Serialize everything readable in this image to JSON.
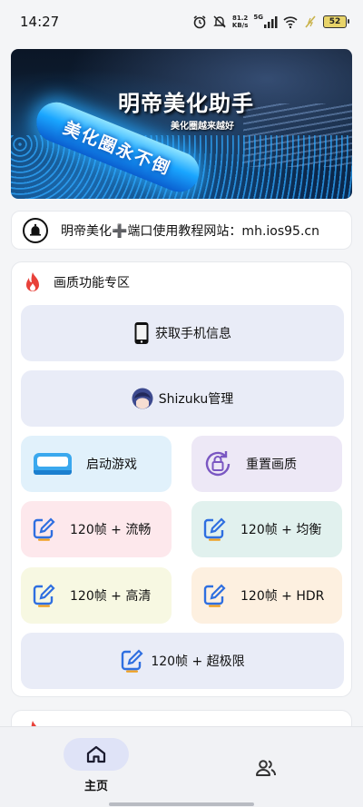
{
  "status_bar": {
    "time": "14:27",
    "net_speed_value": "81.2",
    "net_speed_unit": "KB/s",
    "signal_label": "5G",
    "battery": "52"
  },
  "banner": {
    "title": "明帝美化助手",
    "subtitle": "美化圈越来越好",
    "glowstick_text": "美化圈永不倒"
  },
  "notice": {
    "icon": "bell-icon",
    "text": "明帝美化➕端口使用教程网站：mh.ios95.cn"
  },
  "section": {
    "icon": "fire-icon",
    "title": "画质功能专区",
    "buttons": {
      "phone_info": "获取手机信息",
      "shizuku": "Shizuku管理",
      "launch_game": "启动游戏",
      "reset_quality": "重置画质",
      "fps_smooth": "120帧 + 流畅",
      "fps_balanced": "120帧 + 均衡",
      "fps_hd": "120帧 + 高清",
      "fps_hdr": "120帧 + HDR",
      "fps_ultra": "120帧 + 超极限"
    },
    "colors": {
      "full": "#e9ecf7",
      "launch_game": "#e1f1fb",
      "reset_quality": "#ede8f6",
      "fps_smooth": "#fde8ec",
      "fps_balanced": "#e1f1ee",
      "fps_hd": "#f7f8e2",
      "fps_hdr": "#fdf0e0"
    }
  },
  "bottom_nav": {
    "home_label": "主页",
    "home_icon": "home-icon",
    "users_icon": "users-icon"
  }
}
